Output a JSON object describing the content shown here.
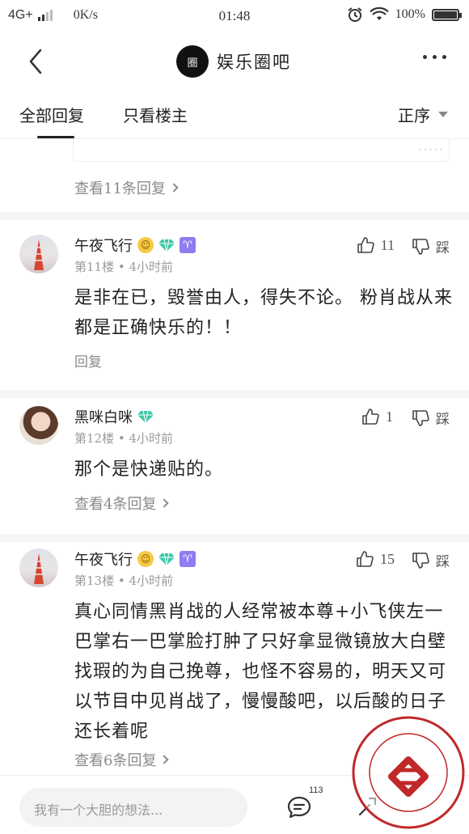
{
  "status_bar": {
    "network": "4G+",
    "speed": "0K/s",
    "time": "01:48",
    "battery": "100%"
  },
  "header": {
    "forum_logo_text": "圈",
    "forum_title": "娱乐圈吧",
    "back_icon": "chevron-left-icon",
    "more_icon": "more-dots-icon"
  },
  "tabs": {
    "all": "全部回复",
    "op_only": "只看楼主",
    "sort": "正序"
  },
  "previous": {
    "view_replies": "查看11条回复"
  },
  "comments": [
    {
      "username": "午夜飞行",
      "floor": "第11楼",
      "time": "4小时前",
      "likes": "11",
      "dislike_label": "踩",
      "body": "是非在已，毁誉由人，得失不论。 粉肖战从来都是正确快乐的！！",
      "reply_label": "回复"
    },
    {
      "username": "黑咪白咪",
      "floor": "第12楼",
      "time": "4小时前",
      "likes": "1",
      "dislike_label": "踩",
      "body": "那个是快递贴的。",
      "view_replies": "查看4条回复"
    },
    {
      "username": "午夜飞行",
      "floor": "第13楼",
      "time": "4小时前",
      "likes": "15",
      "dislike_label": "踩",
      "body": "真心同情黑肖战的人经常被本尊+小飞侠左一巴掌右一巴掌脸打肿了只好拿显微镜放大白壁找瑕的为自己挽尊，也怪不容易的，明天又可以节目中见肖战了，慢慢酸吧，以后酸的日子还长着呢",
      "view_replies": "查看6条回复"
    }
  ],
  "bottom_bar": {
    "input_placeholder": "我有一个大胆的想法...",
    "comment_count": "113"
  },
  "colors": {
    "text": "#222222",
    "muted": "#8a8a8a",
    "zodiac_badge": "#8f7cf0",
    "diamond_badge": "#3cc8a8",
    "stamp": "#c0282a"
  }
}
